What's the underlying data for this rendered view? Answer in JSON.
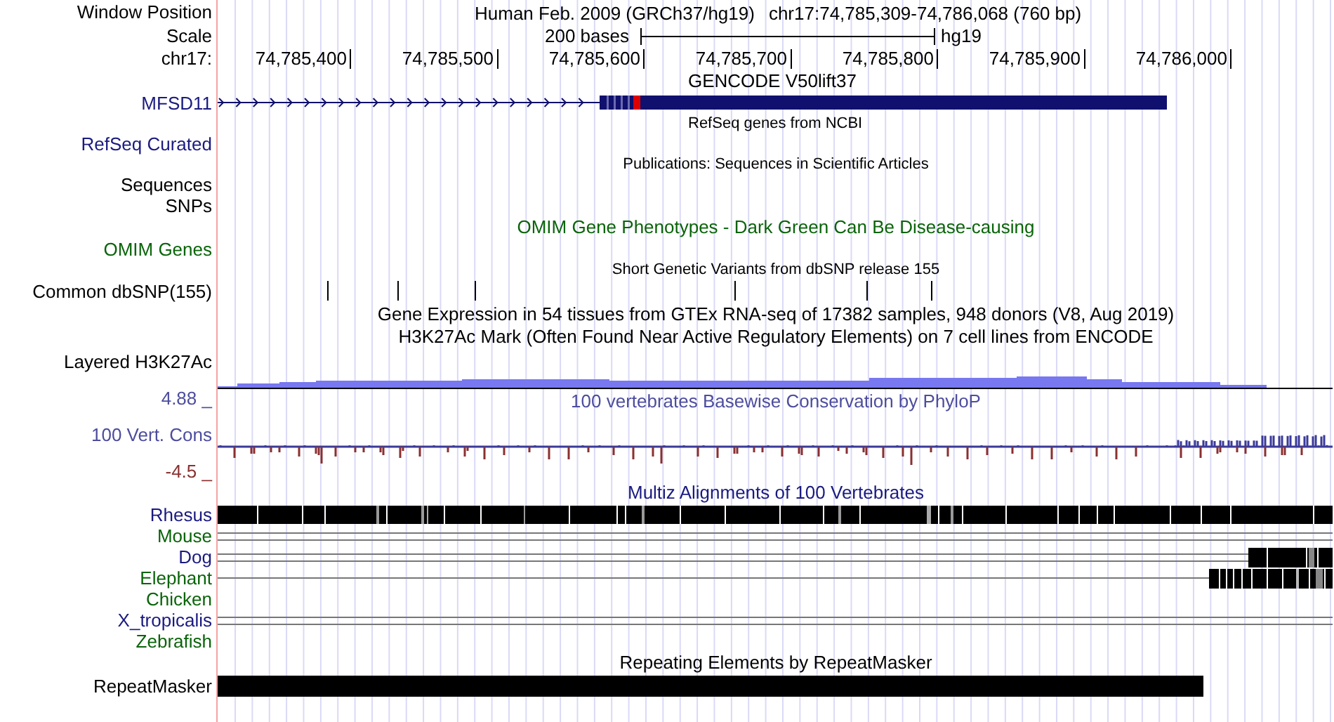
{
  "header": {
    "label": "Window Position",
    "assembly": "Human Feb. 2009 (GRCh37/hg19)",
    "position": "chr17:74,785,309-74,786,068 (760 bp)"
  },
  "scale": {
    "label": "Scale",
    "length": "200 bases",
    "assembly": "hg19"
  },
  "ruler": {
    "label": "chr17:",
    "ticks": [
      "74,785,400",
      "74,785,500",
      "74,785,600",
      "74,785,700",
      "74,785,800",
      "74,785,900",
      "74,786,000"
    ]
  },
  "tracks": [
    {
      "kind": "gene-title",
      "title": "GENCODE V50lift37",
      "color": "#000000"
    },
    {
      "kind": "gene",
      "label": "MFSD11",
      "color": "#1a1a80"
    },
    {
      "kind": "gene-subtitle",
      "title": "RefSeq genes from NCBI",
      "color": "#000000"
    },
    {
      "kind": "label",
      "label": "RefSeq Curated",
      "color": "#1a1a80"
    },
    {
      "kind": "subtitle",
      "title": "Publications: Sequences in Scientific Articles",
      "color": "#000000"
    },
    {
      "kind": "label",
      "label": "Sequences",
      "color": "#000000"
    },
    {
      "kind": "label",
      "label": "SNPs",
      "color": "#000000"
    },
    {
      "kind": "title",
      "title": "OMIM Gene Phenotypes - Dark Green Can Be Disease-causing",
      "color": "#0a640a"
    },
    {
      "kind": "label",
      "label": "OMIM Genes",
      "color": "#0a640a"
    },
    {
      "kind": "subtitle",
      "title": "Short Genetic Variants from dbSNP release 155",
      "color": "#000000"
    },
    {
      "kind": "snps",
      "label": "Common dbSNP(155)",
      "color": "#000000"
    },
    {
      "kind": "title",
      "title": "Gene Expression in 54 tissues from GTEx RNA-seq of 17382 samples, 948 donors (V8, Aug 2019)",
      "color": "#000000"
    },
    {
      "kind": "title",
      "title": "H3K27Ac Mark (Often Found Near Active Regulatory Elements) on 7 cell lines from ENCODE",
      "color": "#000000"
    },
    {
      "kind": "density",
      "label": "Layered H3K27Ac",
      "color": "#000000"
    },
    {
      "kind": "wiggle",
      "label": "100 Vert. Cons",
      "max": "4.88 _",
      "min": "-4.5 _",
      "title": "100 vertebrates Basewise Conservation by PhyloP",
      "color": "#4d4d9e"
    },
    {
      "kind": "title",
      "title": "Multiz Alignments of 100 Vertebrates",
      "color": "#1a1a80"
    },
    {
      "kind": "full-alignment",
      "label": "Rhesus",
      "color": "#1a1a80"
    },
    {
      "kind": "paired-lines",
      "label": "Mouse",
      "color": "#0a640a"
    },
    {
      "kind": "paired-lines-blocks",
      "label": "Dog",
      "color": "#1a1a80"
    },
    {
      "kind": "line-blocks",
      "label": "Elephant",
      "color": "#0a640a"
    },
    {
      "kind": "no-alignment",
      "label": "Chicken",
      "color": "#0a640a"
    },
    {
      "kind": "paired-lines",
      "label": "X_tropicalis",
      "color": "#1a1a80"
    },
    {
      "kind": "no-alignment",
      "label": "Zebrafish",
      "color": "#0a640a"
    },
    {
      "kind": "title",
      "title": "Repeating Elements by RepeatMasker",
      "color": "#000000"
    },
    {
      "kind": "repeat",
      "label": "RepeatMasker",
      "color": "#000000"
    }
  ]
}
